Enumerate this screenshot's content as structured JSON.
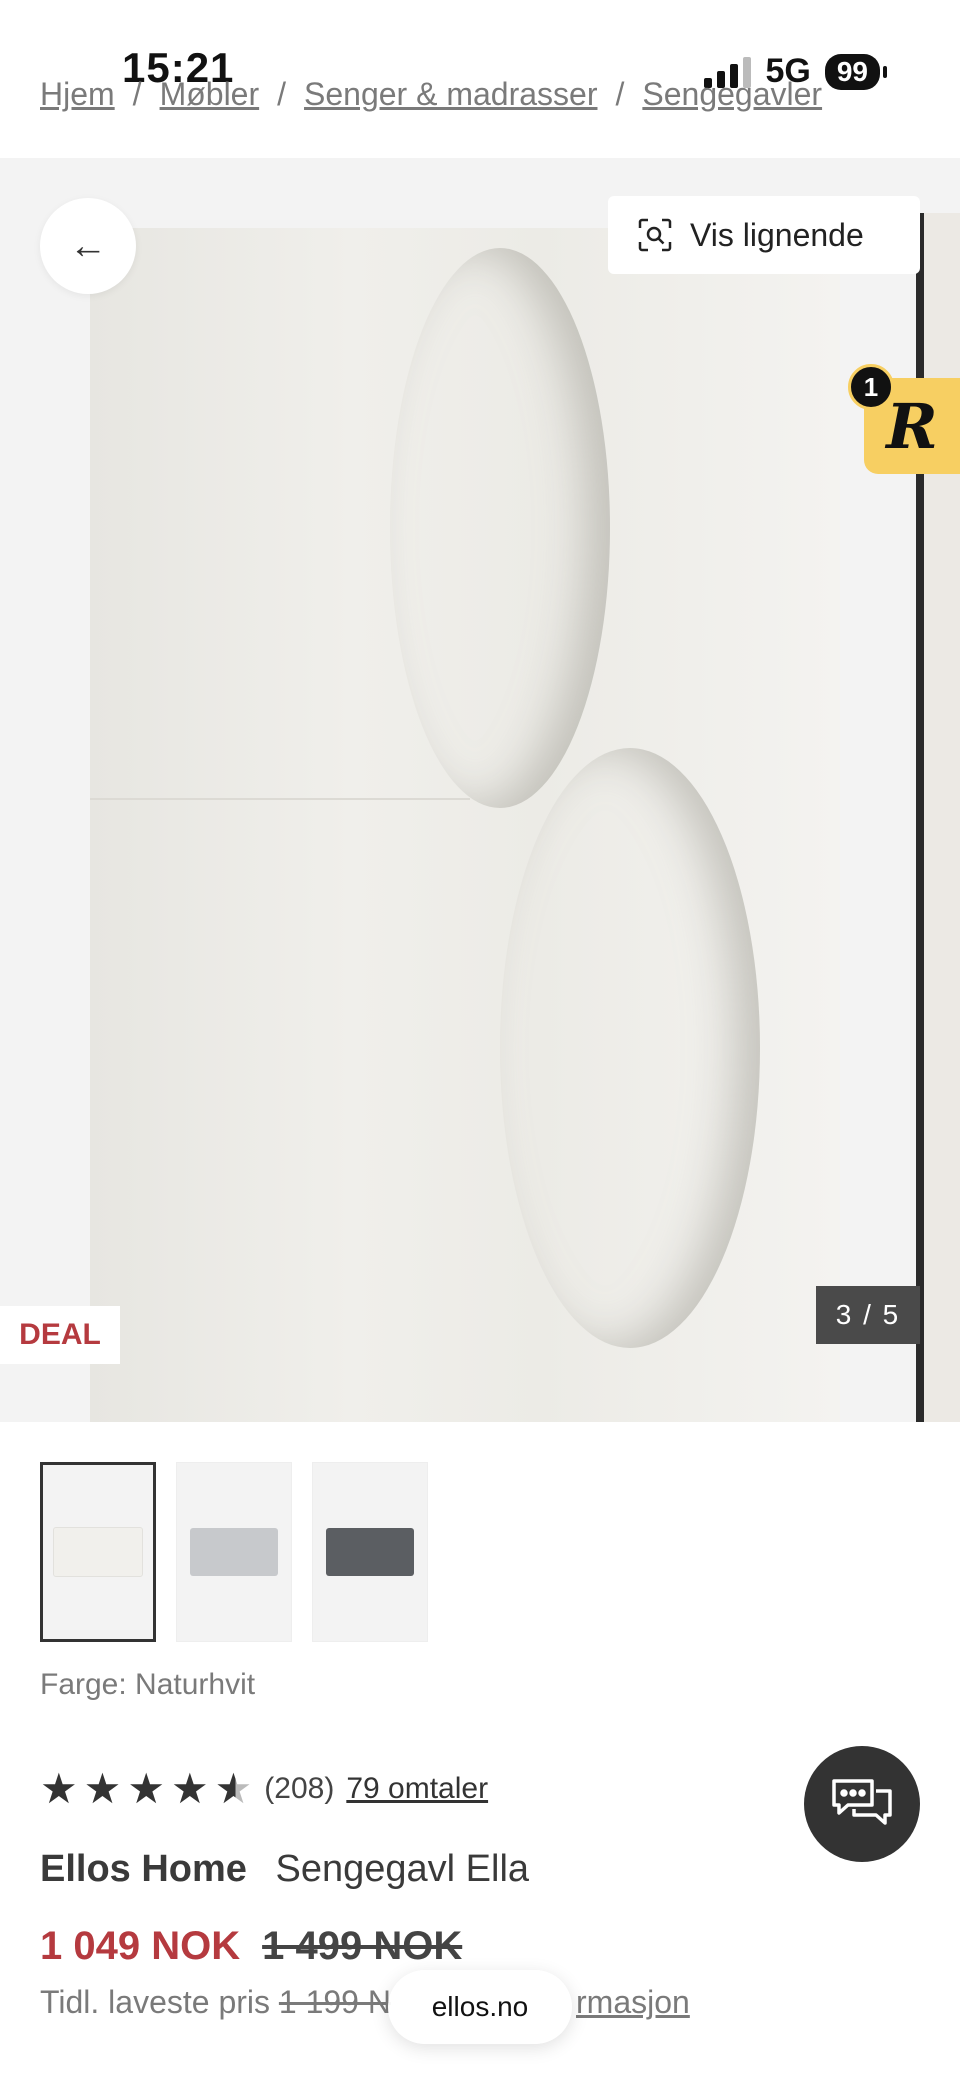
{
  "status_bar": {
    "time": "15:21",
    "network": "5G",
    "battery": "99"
  },
  "breadcrumb": [
    {
      "label": "Hjem"
    },
    {
      "label": "Møbler"
    },
    {
      "label": "Senger & madrasser"
    },
    {
      "label": "Sengegavler"
    }
  ],
  "gallery": {
    "similar_label": "Vis lignende",
    "badge_count": "1",
    "badge_letter": "R",
    "deal_label": "DEAL",
    "counter": "3 / 5",
    "current_index": 3,
    "total_images": 5
  },
  "thumbnails": [
    {
      "name": "thumb-natural-white",
      "color": "#f1f0ec"
    },
    {
      "name": "thumb-light-grey",
      "color": "#c7c9cc"
    },
    {
      "name": "thumb-dark-grey",
      "color": "#5b5e62"
    }
  ],
  "product": {
    "color_label": "Farge: Naturhvit",
    "rating_value": 4.5,
    "rating_count": "(208)",
    "reviews_link": "79 omtaler",
    "brand": "Ellos Home",
    "name": "Sengegavl Ella",
    "price_now": "1 049 NOK",
    "price_old": "1 499 NOK",
    "prev_lowest_label": "Tidl. laveste pris",
    "prev_lowest_value": "1 199 N",
    "info_link": "rmasjon"
  },
  "browser": {
    "url": "ellos.no"
  },
  "colors": {
    "accent_red": "#b53a3f",
    "badge_yellow": "#f7cf62",
    "dark": "#333333"
  }
}
